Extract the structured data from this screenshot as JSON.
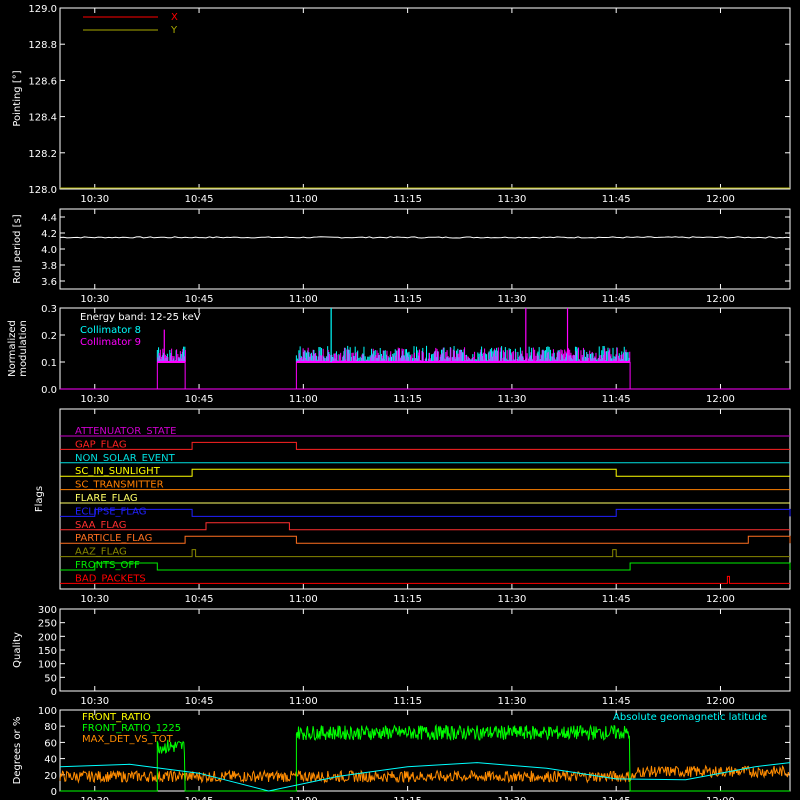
{
  "time_axis": {
    "labels": [
      "10:30",
      "10:45",
      "11:00",
      "11:15",
      "11:30",
      "11:45",
      "12:00"
    ],
    "minutes": [
      630,
      645,
      660,
      675,
      690,
      705,
      720
    ]
  },
  "chart_data": [
    {
      "type": "line",
      "panel": "pointing",
      "ylabel": "Pointing [°]",
      "ylim": [
        128.0,
        129.0
      ],
      "yticks": [
        "128.0",
        "128.2",
        "128.4",
        "128.6",
        "128.8",
        "129.0"
      ],
      "legend": [
        {
          "name": "X",
          "color": "#ff0000"
        },
        {
          "name": "Y",
          "color": "#aaaa00"
        }
      ],
      "series": [
        {
          "name": "Y",
          "color": "#aaaa00",
          "x": [
            "10:25",
            "12:10"
          ],
          "values": [
            128.0,
            128.0
          ]
        }
      ]
    },
    {
      "type": "line",
      "panel": "roll_period",
      "ylabel": "Roll period [s]",
      "ylim": [
        3.5,
        4.5
      ],
      "yticks": [
        "3.6",
        "3.8",
        "4.0",
        "4.2",
        "4.4"
      ],
      "series": [
        {
          "name": "roll",
          "color": "#ffffff",
          "values": [
            4.15,
            4.15,
            4.14,
            4.15,
            4.14,
            4.15
          ]
        }
      ]
    },
    {
      "type": "line",
      "panel": "modulation",
      "ylabel": "Normalized modulation",
      "ylim": [
        0.0,
        0.3
      ],
      "yticks": [
        "0.0",
        "0.1",
        "0.2",
        "0.3"
      ],
      "annotation": "Energy band: 12-25 keV",
      "legend": [
        {
          "name": "Collimator 8",
          "color": "#00ffff"
        },
        {
          "name": "Collimator 9",
          "color": "#ff00ff"
        }
      ],
      "active_intervals": [
        [
          "10:39",
          "10:43"
        ],
        [
          "10:59",
          "11:47"
        ]
      ],
      "baseline": 0.1,
      "spikes": [
        {
          "time": "11:04",
          "value": 0.31,
          "color": "#00ffff"
        },
        {
          "time": "11:32",
          "value": 0.31,
          "color": "#ff00ff"
        },
        {
          "time": "11:38",
          "value": 0.31,
          "color": "#ff00ff"
        },
        {
          "time": "10:40",
          "value": 0.22,
          "color": "#ff00ff"
        }
      ]
    },
    {
      "type": "flags",
      "panel": "flags",
      "ylabel": "Flags",
      "flags": [
        {
          "name": "ATTENUATOR_STATE",
          "color": "#cc00cc",
          "on": []
        },
        {
          "name": "GAP_FLAG",
          "color": "#ff2222",
          "on": [
            [
              "10:44",
              "10:59"
            ]
          ]
        },
        {
          "name": "NON_SOLAR_EVENT",
          "color": "#00e0e0",
          "on": []
        },
        {
          "name": "SC_IN_SUNLIGHT",
          "color": "#ffff00",
          "on": [
            [
              "10:44",
              "11:45"
            ]
          ]
        },
        {
          "name": "SC_TRANSMITTER",
          "color": "#ff7f00",
          "on": []
        },
        {
          "name": "FLARE_FLAG",
          "color": "#ffff66",
          "on": []
        },
        {
          "name": "ECLIPSE_FLAG",
          "color": "#2020ff",
          "on": [
            [
              "10:30",
              "10:44"
            ],
            [
              "11:45",
              "12:10"
            ]
          ]
        },
        {
          "name": "SAA_FLAG",
          "color": "#ff3030",
          "on": [
            [
              "10:46",
              "10:58"
            ]
          ]
        },
        {
          "name": "PARTICLE_FLAG",
          "color": "#ff7020",
          "on": [
            [
              "10:43",
              "10:59"
            ],
            [
              "12:04",
              "12:10"
            ]
          ]
        },
        {
          "name": "AAZ_FLAG",
          "color": "#888800",
          "on": [
            [
              "10:44",
              "10:44.5"
            ],
            [
              "11:44.5",
              "11:45"
            ]
          ]
        },
        {
          "name": "FRONTS_OFF",
          "color": "#00ee00",
          "on": [
            [
              "10:30",
              "10:39"
            ],
            [
              "11:47",
              "12:10"
            ]
          ]
        },
        {
          "name": "BAD_PACKETS",
          "color": "#ff0000",
          "on": [
            [
              "12:01",
              "12:01.3"
            ]
          ]
        }
      ]
    },
    {
      "type": "line",
      "panel": "quality",
      "ylabel": "Quality",
      "ylim": [
        0,
        300
      ],
      "yticks": [
        "0",
        "50",
        "100",
        "150",
        "200",
        "250",
        "300"
      ],
      "series": []
    },
    {
      "type": "line",
      "panel": "ratios",
      "ylabel": "Degrees or %",
      "ylim": [
        0,
        100
      ],
      "yticks": [
        "0",
        "20",
        "40",
        "60",
        "80",
        "100"
      ],
      "annotation": "Absolute geomagnetic latitude",
      "annotation_color": "#00ffff",
      "legend": [
        {
          "name": "FRONT_RATIO",
          "color": "#ffff00"
        },
        {
          "name": "FRONT_RATIO_1225",
          "color": "#00ff00"
        },
        {
          "name": "MAX_DET_VS_TOT",
          "color": "#ff8c00"
        }
      ],
      "series": [
        {
          "name": "FRONT_RATIO_1225",
          "color": "#00ff00",
          "intervals": [
            [
              "10:39",
              "10:43",
              55
            ],
            [
              "10:59",
              "11:47",
              72
            ]
          ]
        },
        {
          "name": "MAX_DET_VS_TOT",
          "color": "#ff8c00",
          "level": 18
        },
        {
          "name": "Absolute geomagnetic latitude",
          "color": "#00ffff",
          "x": [
            "10:25",
            "10:35",
            "10:45",
            "10:55",
            "11:05",
            "11:15",
            "11:25",
            "11:35",
            "11:45",
            "11:55",
            "12:05",
            "12:10"
          ],
          "values": [
            30,
            33,
            22,
            0,
            18,
            30,
            35,
            28,
            15,
            14,
            30,
            35
          ]
        }
      ]
    }
  ]
}
